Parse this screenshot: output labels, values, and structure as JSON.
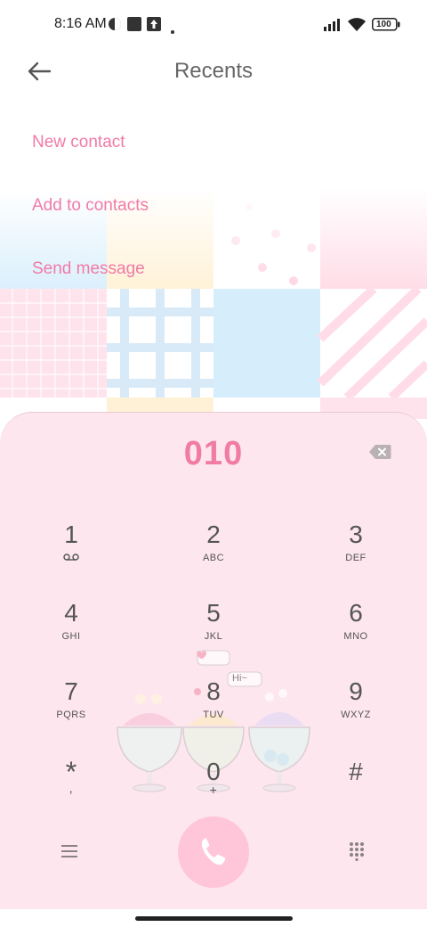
{
  "status": {
    "time": "8:16 AM",
    "battery": "100"
  },
  "header": {
    "title": "Recents"
  },
  "actions": [
    "New contact",
    "Add to contacts",
    "Send message"
  ],
  "dialer": {
    "number": "010",
    "keys": [
      {
        "digit": "1",
        "sub": ""
      },
      {
        "digit": "2",
        "sub": "ABC"
      },
      {
        "digit": "3",
        "sub": "DEF"
      },
      {
        "digit": "4",
        "sub": "GHI"
      },
      {
        "digit": "5",
        "sub": "JKL"
      },
      {
        "digit": "6",
        "sub": "MNO"
      },
      {
        "digit": "7",
        "sub": "PQRS"
      },
      {
        "digit": "8",
        "sub": "TUV"
      },
      {
        "digit": "9",
        "sub": "WXYZ"
      },
      {
        "digit": "*",
        "sub": ","
      },
      {
        "digit": "0",
        "sub": "+"
      },
      {
        "digit": "#",
        "sub": ""
      }
    ]
  },
  "theme": {
    "bubble_text": "Hi~",
    "accent": "#f07ca3",
    "call_button": "#ffc5d8",
    "panel": "#fde6ee"
  },
  "icons": {
    "back": "arrow-left-icon",
    "backspace": "backspace-icon",
    "voicemail": "voicemail-icon",
    "menu": "menu-icon",
    "call": "phone-icon",
    "keypad": "dialpad-icon"
  }
}
